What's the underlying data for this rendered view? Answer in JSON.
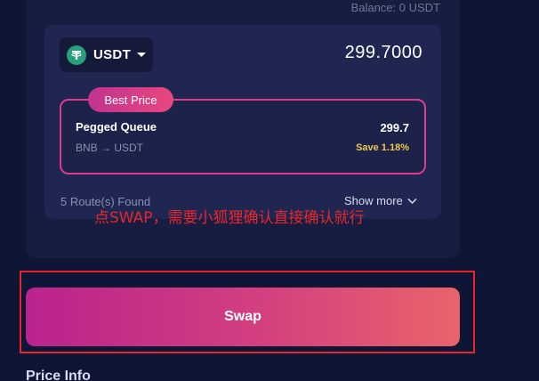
{
  "balance": "Balance: 0 USDT",
  "token": {
    "name": "USDT",
    "icon": "tether-icon",
    "icon_color": "#26a17b"
  },
  "amount": "299.7000",
  "best_route": {
    "badge": "Best Price",
    "name": "Pegged Queue",
    "path": "BNB → USDT",
    "value": "299.7",
    "save": "Save 1.18%"
  },
  "routes_found": "5 Route(s) Found",
  "show_more": "Show more",
  "annotation": "点SWAP，需要小狐狸确认直接确认就行",
  "swap_label": "Swap",
  "price_info_title": "Price Info",
  "colors": {
    "background": "#0f1535",
    "accent_pink": "#e03a8c",
    "save_yellow": "#f3c54c",
    "annotation_red": "#e8262a"
  }
}
